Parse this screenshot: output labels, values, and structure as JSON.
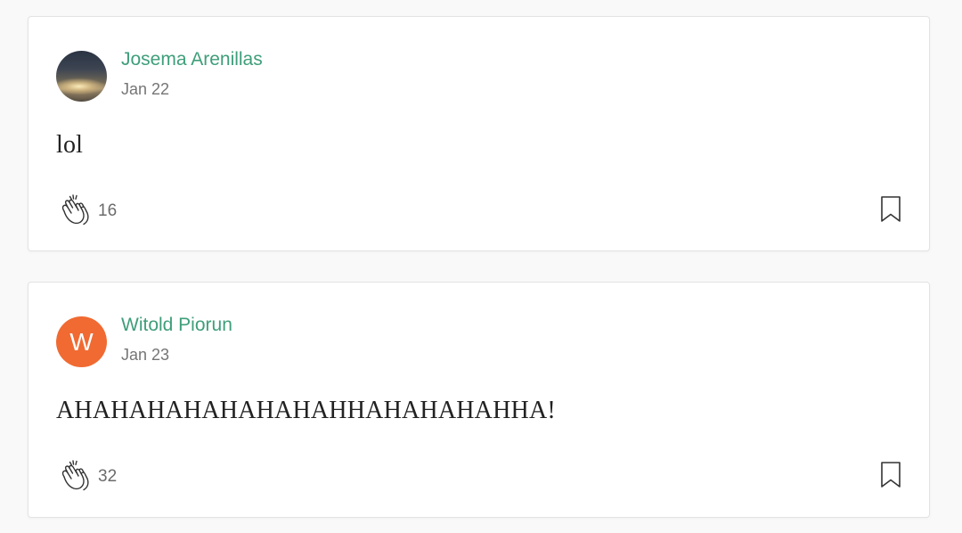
{
  "responses": [
    {
      "author": "Josema Arenillas",
      "date": "Jan 22",
      "text": "lol",
      "claps": "16",
      "avatar": {
        "type": "photo",
        "letter": ""
      }
    },
    {
      "author": "Witold Piorun",
      "date": "Jan 23",
      "text": "AHAHAHAHAHAHAHAHHAHAHAHAHHA!",
      "claps": "32",
      "avatar": {
        "type": "letter",
        "letter": "W"
      }
    }
  ],
  "colors": {
    "author": "#3e9e7a",
    "avatar_letter_bg": "#f06a32",
    "meta": "#757575"
  },
  "icons": {
    "clap": "clap-icon",
    "bookmark": "bookmark-icon"
  }
}
